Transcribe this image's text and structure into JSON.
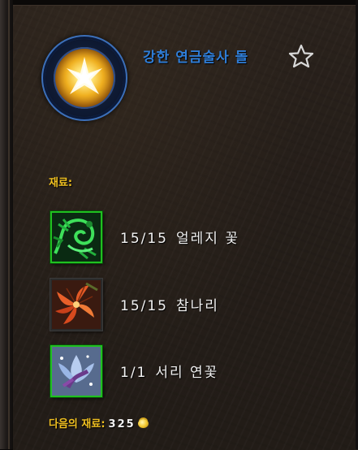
{
  "recipe": {
    "title": "강한 연금술사 돌",
    "icon": "alchemist-stone-icon",
    "favorite_icon": "star-outline-icon"
  },
  "reagents_section": {
    "label": "재료:",
    "items": [
      {
        "count": "15/15",
        "name": "얼레지 꽃",
        "icon": "herb-green-icon",
        "quality_color": "#20c020"
      },
      {
        "count": "15/15",
        "name": "참나리",
        "icon": "tiger-lily-icon",
        "quality_color": "#2a2a2a"
      },
      {
        "count": "1/1",
        "name": "서리 연꽃",
        "icon": "frost-lotus-icon",
        "quality_color": "#20c020"
      }
    ]
  },
  "footer": {
    "label": "다음의 재료:",
    "value": "325",
    "currency_icon": "gold-coin-icon"
  },
  "colors": {
    "title": "#2f7ed8",
    "section_label": "#f0c020",
    "reagent_text": "#f2f2f2"
  }
}
